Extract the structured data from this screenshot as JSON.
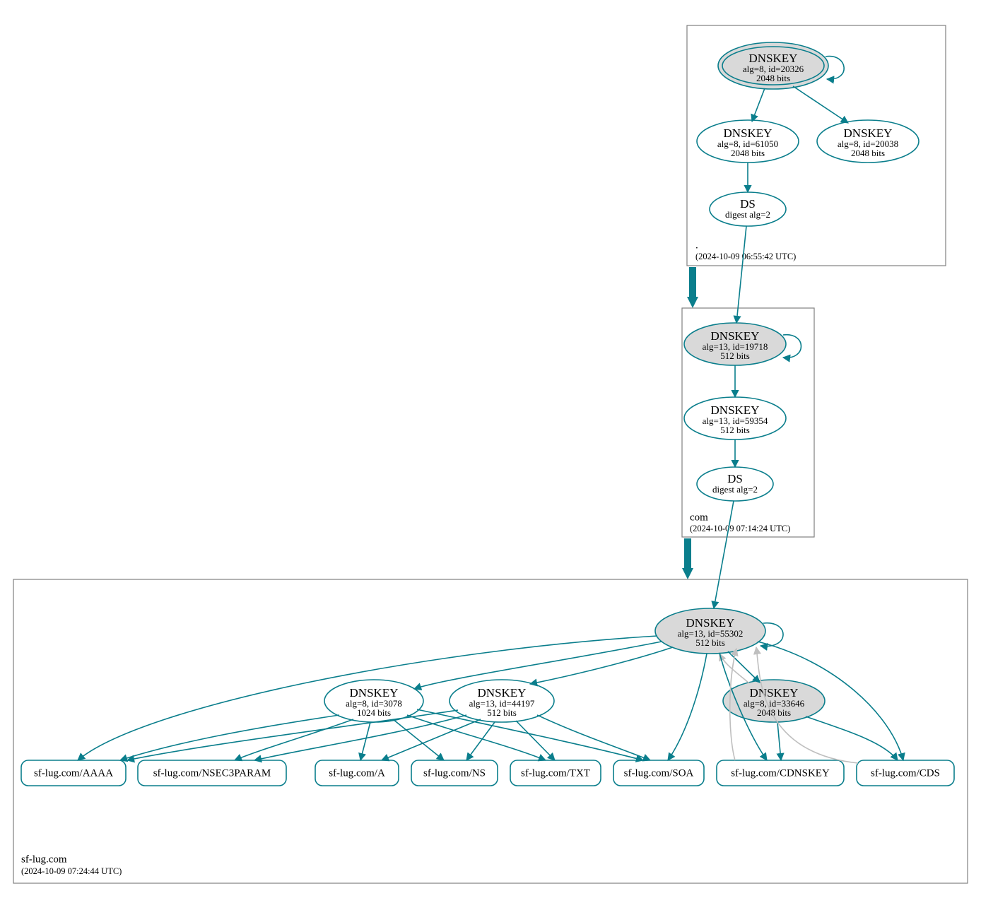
{
  "zones": {
    "root": {
      "name": ".",
      "timestamp": "(2024-10-09 06:55:42 UTC)"
    },
    "com": {
      "name": "com",
      "timestamp": "(2024-10-09 07:14:24 UTC)"
    },
    "domain": {
      "name": "sf-lug.com",
      "timestamp": "(2024-10-09 07:24:44 UTC)"
    }
  },
  "nodes": {
    "root_ksk": {
      "title": "DNSKEY",
      "line2": "alg=8, id=20326",
      "line3": "2048 bits"
    },
    "root_zsk1": {
      "title": "DNSKEY",
      "line2": "alg=8, id=61050",
      "line3": "2048 bits"
    },
    "root_zsk2": {
      "title": "DNSKEY",
      "line2": "alg=8, id=20038",
      "line3": "2048 bits"
    },
    "root_ds": {
      "title": "DS",
      "line2": "digest alg=2"
    },
    "com_ksk": {
      "title": "DNSKEY",
      "line2": "alg=13, id=19718",
      "line3": "512 bits"
    },
    "com_zsk": {
      "title": "DNSKEY",
      "line2": "alg=13, id=59354",
      "line3": "512 bits"
    },
    "com_ds": {
      "title": "DS",
      "line2": "digest alg=2"
    },
    "dom_ksk": {
      "title": "DNSKEY",
      "line2": "alg=13, id=55302",
      "line3": "512 bits"
    },
    "dom_zsk1": {
      "title": "DNSKEY",
      "line2": "alg=8, id=3078",
      "line3": "1024 bits"
    },
    "dom_zsk2": {
      "title": "DNSKEY",
      "line2": "alg=13, id=44197",
      "line3": "512 bits"
    },
    "dom_zsk3": {
      "title": "DNSKEY",
      "line2": "alg=8, id=33646",
      "line3": "2048 bits"
    }
  },
  "rr": {
    "aaaa": "sf-lug.com/AAAA",
    "nsec3": "sf-lug.com/NSEC3PARAM",
    "a": "sf-lug.com/A",
    "ns": "sf-lug.com/NS",
    "txt": "sf-lug.com/TXT",
    "soa": "sf-lug.com/SOA",
    "cdnskey": "sf-lug.com/CDNSKEY",
    "cds": "sf-lug.com/CDS"
  },
  "colors": {
    "teal": "#0a7e8c",
    "grey_node": "#d9d9d9",
    "grey_edge": "#bfbfbf",
    "grey_box": "#808080"
  }
}
